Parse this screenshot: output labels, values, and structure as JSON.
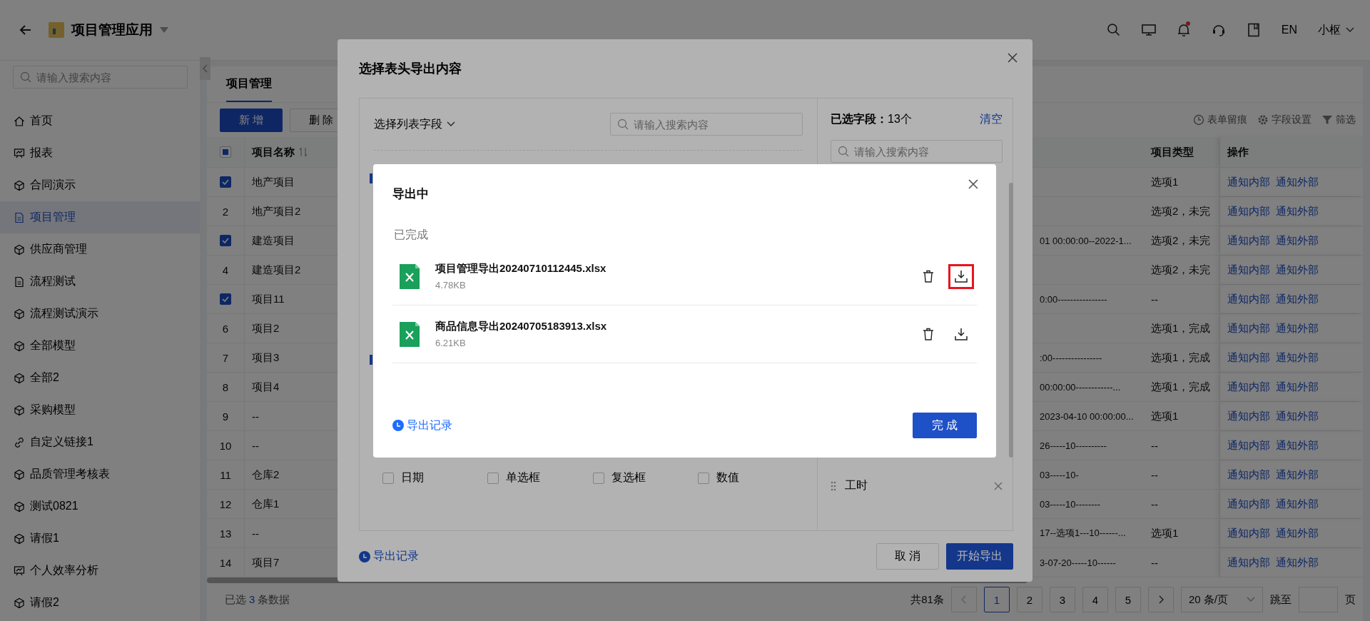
{
  "topbar": {
    "title": "项目管理应用",
    "lang": "EN",
    "user": "小枢",
    "has_notification": true
  },
  "sidebar": {
    "search_placeholder": "请输入搜索内容",
    "items": [
      {
        "label": "首页",
        "kind": "home",
        "selected": false
      },
      {
        "label": "报表",
        "kind": "board",
        "selected": false
      },
      {
        "label": "合同演示",
        "kind": "cube",
        "selected": false
      },
      {
        "label": "项目管理",
        "kind": "doc",
        "selected": true
      },
      {
        "label": "供应商管理",
        "kind": "cube",
        "selected": false
      },
      {
        "label": "流程测试",
        "kind": "doc",
        "selected": false
      },
      {
        "label": "流程测试演示",
        "kind": "cube",
        "selected": false
      },
      {
        "label": "全部模型",
        "kind": "cube",
        "selected": false
      },
      {
        "label": "全部2",
        "kind": "cube",
        "selected": false
      },
      {
        "label": "采购模型",
        "kind": "cube",
        "selected": false
      },
      {
        "label": "自定义链接1",
        "kind": "link",
        "selected": false
      },
      {
        "label": "品质管理考核表",
        "kind": "cube",
        "selected": false
      },
      {
        "label": "测试0821",
        "kind": "cube",
        "selected": false
      },
      {
        "label": "请假1",
        "kind": "cube",
        "selected": false
      },
      {
        "label": "个人效率分析",
        "kind": "board",
        "selected": false
      },
      {
        "label": "请假2",
        "kind": "cube",
        "selected": false
      }
    ]
  },
  "tabs": [
    {
      "label": "项目管理",
      "selected": true
    }
  ],
  "toolbar": {
    "buttons": [
      {
        "label": "新 增",
        "kind": "primary"
      },
      {
        "label": "删 除",
        "kind": "default"
      }
    ],
    "actions": [
      {
        "label": "表单留痕",
        "kind": "clock"
      },
      {
        "label": "字段设置",
        "kind": "gear"
      },
      {
        "label": "筛选",
        "kind": "filter"
      }
    ]
  },
  "table": {
    "header_indeterminate": true,
    "columns": {
      "name": "项目名称",
      "type": "项目类型",
      "actions": "操作"
    },
    "rows": [
      {
        "checked": true,
        "name": "地产项目",
        "type": "选项1",
        "actions": [
          "通知内部",
          "通知外部"
        ]
      },
      {
        "checked": false,
        "index": "2",
        "name": "地产项目2",
        "type": "选项2，未完",
        "actions": [
          "通知内部",
          "通知外部"
        ]
      },
      {
        "checked": true,
        "name": "建造项目",
        "column_3": "01 00:00:00--2022-1...",
        "type": "选项2，未完",
        "actions": [
          "通知内部",
          "通知外部"
        ]
      },
      {
        "checked": false,
        "index": "4",
        "name": "建造项目2",
        "type": "选项2，未完",
        "actions": [
          "通知内部",
          "通知外部"
        ]
      },
      {
        "checked": true,
        "name": "项目11",
        "column_3": "0:00----------------",
        "type": "--",
        "actions": [
          "通知内部",
          "通知外部"
        ]
      },
      {
        "checked": false,
        "index": "6",
        "name": "项目2",
        "type": "选项1，完成",
        "actions": [
          "通知内部",
          "通知外部"
        ]
      },
      {
        "checked": false,
        "index": "7",
        "name": "项目3",
        "column_3": ":00----------------",
        "type": "选项1，完成",
        "actions": [
          "通知内部",
          "通知外部"
        ]
      },
      {
        "checked": false,
        "index": "8",
        "name": "项目4",
        "column_3": "00:00:00------------...",
        "type": "选项1，完成",
        "actions": [
          "通知内部",
          "通知外部"
        ]
      },
      {
        "checked": false,
        "index": "9",
        "name": "--",
        "column_3": "2023-04-10 00:00:00...",
        "type": "选项1",
        "actions": [
          "通知内部",
          "通知外部"
        ]
      },
      {
        "checked": false,
        "index": "10",
        "name": "--",
        "column_3": "26-----10----------",
        "type": "--",
        "actions": [
          "通知内部",
          "通知外部"
        ]
      },
      {
        "checked": false,
        "index": "11",
        "name": "仓库2",
        "column_3": "03-----10-",
        "type": "--",
        "actions": [
          "通知内部",
          "通知外部"
        ]
      },
      {
        "checked": false,
        "index": "12",
        "name": "仓库1",
        "column_3": "03-----10--------",
        "type": "--",
        "actions": [
          "通知内部",
          "通知外部"
        ]
      },
      {
        "checked": false,
        "index": "13",
        "name": "--",
        "column_3": "17--选项1---10------...",
        "type": "选项1",
        "actions": [
          "通知内部",
          "通知外部"
        ]
      },
      {
        "checked": false,
        "index": "14",
        "name": "项目7",
        "column_3": "3-07-20-----10------",
        "type": "--",
        "actions": [
          "通知内部",
          "通知外部"
        ]
      }
    ]
  },
  "footer": {
    "selected_prefix": "已选",
    "selected_count": "3",
    "selected_suffix": "条数据",
    "total": "共81条",
    "pages": [
      {
        "label": "1",
        "selected": true
      },
      {
        "label": "2",
        "selected": false
      },
      {
        "label": "3",
        "selected": false
      },
      {
        "label": "4",
        "selected": false
      },
      {
        "label": "5",
        "selected": false
      }
    ],
    "page_size": "20 条/页",
    "jump_label": "跳至",
    "page_unit": "页"
  },
  "export_dialog": {
    "title": "选择表头导出内容",
    "field_picker": "选择列表字段",
    "search_placeholder": "请输入搜索内容",
    "field_options": [
      {
        "label": "日期",
        "checked": false
      },
      {
        "label": "单选框",
        "checked": false
      },
      {
        "label": "复选框",
        "checked": false
      },
      {
        "label": "数值",
        "checked": false
      }
    ],
    "selected_label": "已选字段：",
    "selected_count": "13个",
    "clear": "清空",
    "selected_search_placeholder": "请输入搜索内容",
    "selected_fields": [
      {
        "label": "工时"
      }
    ],
    "history": "导出记录",
    "buttons": [
      {
        "label": "取 消",
        "kind": "default"
      },
      {
        "label": "开始导出",
        "kind": "primary"
      }
    ]
  },
  "progress_dialog": {
    "title": "导出中",
    "section": "已完成",
    "files": [
      {
        "name": "项目管理导出20240710112445.xlsx",
        "size": "4.78KB",
        "highlighted": true
      },
      {
        "name": "商品信息导出20240705183913.xlsx",
        "size": "6.21KB",
        "highlighted": false
      }
    ],
    "history": "导出记录",
    "done": "完 成"
  }
}
